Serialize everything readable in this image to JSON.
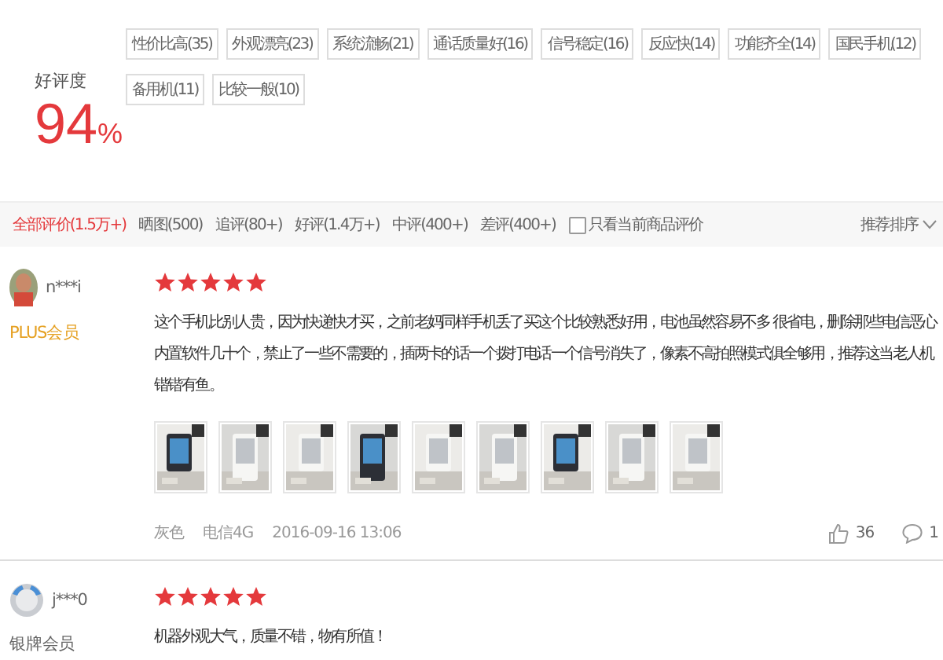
{
  "rating": {
    "label": "好评度",
    "value": "94",
    "unit": "%"
  },
  "tags": [
    "性价比高(35)",
    "外观漂亮(23)",
    "系统流畅(21)",
    "通话质量好(16)",
    "信号稳定(16)",
    "反应快(14)",
    "功能齐全(14)",
    "国民手机(12)",
    "备用机(11)",
    "比较一般(10)"
  ],
  "filter_tabs": [
    {
      "label": "全部评价(1.5万+)",
      "selected": true
    },
    {
      "label": "晒图(500)",
      "selected": false
    },
    {
      "label": "追评(80+)",
      "selected": false
    },
    {
      "label": "好评(1.4万+)",
      "selected": false
    },
    {
      "label": "中评(400+)",
      "selected": false
    },
    {
      "label": "差评(400+)",
      "selected": false
    }
  ],
  "current_only": {
    "label": "只看当前商品评价",
    "checked": false
  },
  "sort": {
    "label": "推荐排序"
  },
  "reviews": [
    {
      "user": "n***i",
      "kind": "plus",
      "level": "PLUS会员",
      "stars": 5,
      "lines": [
        "这个手机比别人贵，因为快递快才买，之前老妈同样手机丢了买这个比较熟悉好用，电池虽然容易不多 很省电，删除那些电信恶心",
        "内置软件几十个，禁止了一些不需要的，插两卡的话一个拨打电话一个信号消失了，像素不高拍照模式俱全够用，推荐这当老人机",
        "锴锴有鱼。"
      ],
      "photos": [
        {
          "kind": "picture"
        },
        {
          "kind": "picture"
        },
        {
          "kind": "picture"
        },
        {
          "kind": "picture"
        },
        {
          "kind": "picture"
        },
        {
          "kind": "picture"
        },
        {
          "kind": "picture"
        },
        {
          "kind": "picture"
        },
        {
          "kind": "picture"
        }
      ],
      "variant": "灰色",
      "network": "电信4G",
      "date": "2016-09-16 13:06",
      "likes": "36",
      "comments": "1"
    },
    {
      "user": "j***0",
      "kind": "silver",
      "level": "银牌会员",
      "stars": 5,
      "lines": [
        "机器外观大气，质量不错，物有所值！"
      ]
    }
  ]
}
